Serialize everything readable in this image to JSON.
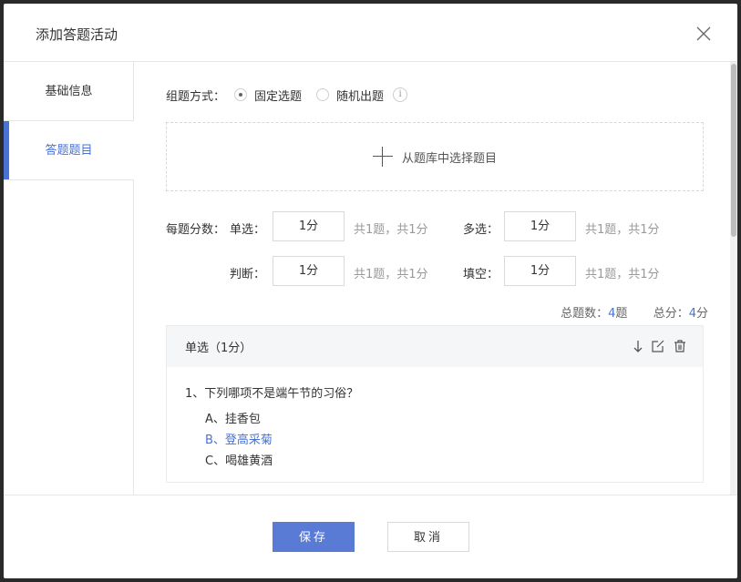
{
  "dialog": {
    "title": "添加答题活动"
  },
  "sidebar": {
    "items": [
      {
        "label": "基础信息"
      },
      {
        "label": "答题题目"
      }
    ]
  },
  "mode": {
    "label": "组题方式：",
    "options": [
      "固定选题",
      "随机出题"
    ],
    "selected": "固定选题",
    "info_glyph": "i"
  },
  "picker": {
    "label": "从题库中选择题目"
  },
  "scores": {
    "label": "每题分数：",
    "single": {
      "label": "单选：",
      "value": "1分",
      "hint": "共1题，共1分"
    },
    "multi": {
      "label": "多选：",
      "value": "1分",
      "hint": "共1题，共1分"
    },
    "judge": {
      "label": "判断：",
      "value": "1分",
      "hint": "共1题，共1分"
    },
    "fill": {
      "label": "填空：",
      "value": "1分",
      "hint": "共1题，共1分"
    }
  },
  "totals": {
    "count_prefix": "总题数：",
    "count": "4",
    "count_suffix": "题",
    "score_prefix": "总分：",
    "score": "4",
    "score_suffix": "分"
  },
  "question": {
    "section_title": "单选（1分）",
    "text": "1、下列哪项不是端午节的习俗？",
    "options": [
      {
        "text": "A、挂香包",
        "correct": false
      },
      {
        "text": "B、登高采菊",
        "correct": true
      },
      {
        "text": "C、喝雄黄酒",
        "correct": false
      }
    ],
    "icons": [
      "arrow-down-icon",
      "edit-icon",
      "trash-icon"
    ]
  },
  "footer": {
    "save_label": "保存",
    "cancel_label": "取消"
  },
  "colors": {
    "accent": "#4a72d4",
    "primary_button": "#5a7bd5"
  }
}
